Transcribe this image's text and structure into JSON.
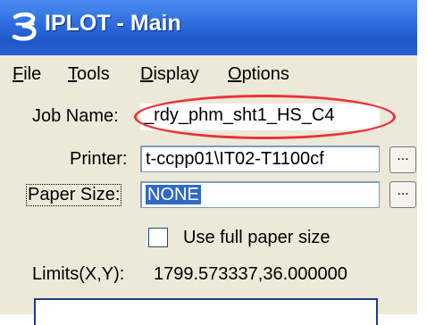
{
  "window": {
    "title": "IPLOT - Main",
    "colors": {
      "titlebar": "#2f6fe0",
      "face": "#ece9d8",
      "highlight": "#316ac5",
      "annotation": "#e8343c"
    }
  },
  "menu": {
    "file": {
      "accel": "F",
      "rest": "ile"
    },
    "tools": {
      "accel": "T",
      "rest": "ools"
    },
    "display": {
      "accel": "D",
      "rest": "isplay"
    },
    "options": {
      "accel": "O",
      "rest": "ptions"
    }
  },
  "form": {
    "job_name_label": "Job Name:",
    "job_name_value": "_rdy_phm_sht1_HS_C4",
    "printer_label": "Printer:",
    "printer_value": "t-ccpp01\\IT02-T1100cf",
    "printer_browse": "...",
    "paper_size_label": "Paper Size:",
    "paper_size_value": "NONE",
    "paper_size_browse": "...",
    "use_full_paper_label": "Use full paper size",
    "use_full_paper_checked": false,
    "limits_label": "Limits(X,Y):",
    "limits_value": "1799.573337,36.000000"
  }
}
